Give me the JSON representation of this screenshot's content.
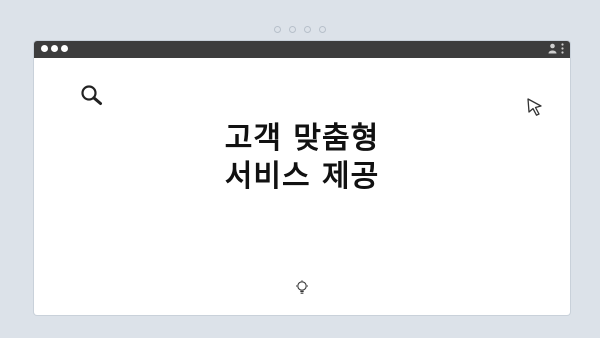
{
  "headline": {
    "line1": "고객 맞춤형",
    "line2": "서비스 제공"
  },
  "icons": {
    "search": "search-icon",
    "cursor": "cursor-icon",
    "idea": "lightbulb-icon",
    "user": "user-icon",
    "menu": "kebab-menu-icon"
  },
  "colors": {
    "titlebar": "#3d3d3d",
    "background": "#dce2e9",
    "window": "#ffffff",
    "text": "#111111"
  }
}
